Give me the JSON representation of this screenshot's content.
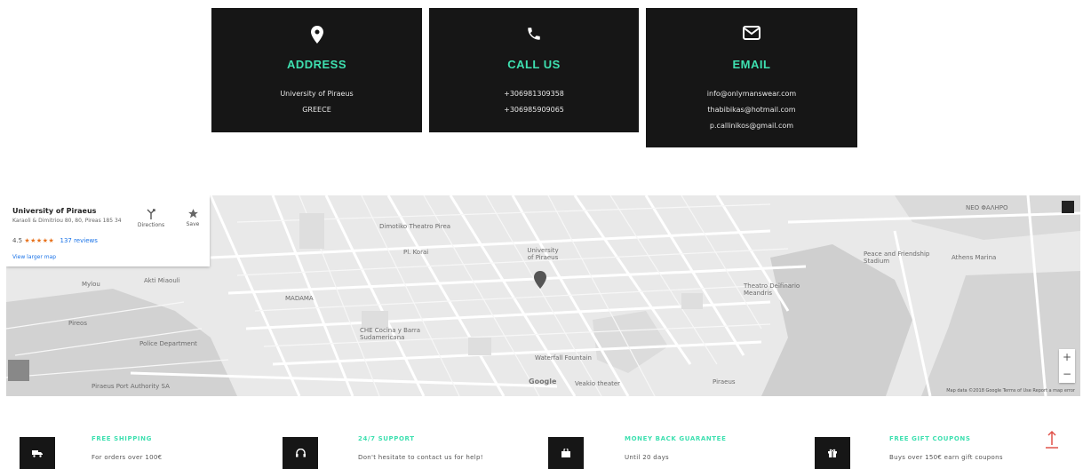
{
  "contact_cards": {
    "address": {
      "icon": "map-pin-icon",
      "title": "ADDRESS",
      "lines": [
        "University of Piraeus",
        "GREECE"
      ]
    },
    "call": {
      "icon": "phone-icon",
      "title": "CALL US",
      "lines": [
        "+306981309358",
        "+306985909065"
      ]
    },
    "email": {
      "icon": "envelope-icon",
      "title": "EMAIL",
      "lines": [
        "info@onlymanswear.com",
        "thabibikas@hotmail.com",
        "p.callinikos@gmail.com"
      ]
    }
  },
  "map": {
    "place_name": "University of Piraeus",
    "place_address": "Karaoli & Dimitriou 80, 80, Pireas 185 34",
    "rating": "4.5",
    "stars": "★★★★★",
    "reviews": "137 reviews",
    "view_larger": "View larger map",
    "directions_label": "Directions",
    "save_label": "Save",
    "zoom_in": "+",
    "zoom_out": "−",
    "google": "Google",
    "footer": "Map data ©2018 Google   Terms of Use   Report a map error",
    "labels": {
      "dimotiko": "Dimotiko Theatro Pirea",
      "pl_korai": "Pl. Korai",
      "madama": "MADAMA",
      "university": "University of Piraeus",
      "che_cocina": "CHE Cocina y Barra Sudamericana",
      "police": "Police Department",
      "port_authority": "Piraeus Port Authority SA",
      "waterfall": "Waterfall Fountain",
      "veakio": "Veakio theater",
      "theatro_delfinario": "Theatro Delfinario Meandris",
      "peace_friendship": "Peace and Friendship Stadium",
      "athens_marina": "Athens Marina",
      "piraeus_metro": "Piraeus",
      "neo_faliro": "ΝΕΟ ΦΑΛΗΡΟ",
      "pireos": "Pireos",
      "akti_miaouli": "Akti Miaouli",
      "mylou": "Mylou"
    }
  },
  "features": [
    {
      "icon": "truck-icon",
      "title": "FREE SHIPPING",
      "desc": "For orders over 100€"
    },
    {
      "icon": "headset-icon",
      "title": "24/7 SUPPORT",
      "desc": "Don't hesitate to contact us for help!"
    },
    {
      "icon": "shopping-bag-icon",
      "title": "MONEY BACK GUARANTEE",
      "desc": "Until 20 days"
    },
    {
      "icon": "gift-icon",
      "title": "FREE GIFT COUPONS",
      "desc": "Buys over 150€ earn gift coupons"
    }
  ],
  "colors": {
    "accent": "#3ee0b0",
    "card_bg": "#161616",
    "totop": "#e0524a"
  }
}
